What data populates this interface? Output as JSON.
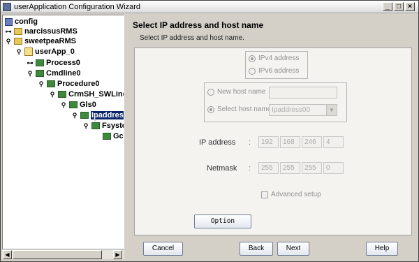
{
  "window": {
    "title": "userApplication Configuration Wizard",
    "controls": [
      "_",
      "□",
      "×"
    ]
  },
  "tree": {
    "items": [
      {
        "label": "config",
        "depth": 0,
        "icon": "config-icon",
        "key": ""
      },
      {
        "label": "narcissusRMS",
        "depth": 0,
        "icon": "node-icon",
        "key": "⊶"
      },
      {
        "label": "sweetpeaRMS",
        "depth": 0,
        "icon": "node-icon",
        "key": "⚲"
      },
      {
        "label": "userApp_0",
        "depth": 1,
        "icon": "app-icon",
        "key": "⚲"
      },
      {
        "label": "Process0",
        "depth": 2,
        "icon": "resource-icon",
        "key": "⊶"
      },
      {
        "label": "Cmdline0",
        "depth": 2,
        "icon": "resource-icon",
        "key": "⚲"
      },
      {
        "label": "Procedure0",
        "depth": 3,
        "icon": "resource-icon",
        "key": "⚲"
      },
      {
        "label": "CrmSH_SWLine",
        "depth": 4,
        "icon": "resource-icon",
        "key": "⚲"
      },
      {
        "label": "Gls0",
        "depth": 5,
        "icon": "resource-icon",
        "key": "⚲"
      },
      {
        "label": "Ipaddress",
        "depth": 6,
        "icon": "resource-icon",
        "key": "⚲",
        "selected": true
      },
      {
        "label": "Fsyste",
        "depth": 7,
        "icon": "resource-icon",
        "key": "⚲"
      },
      {
        "label": "Gc",
        "depth": 8,
        "icon": "resource-icon",
        "key": ""
      }
    ]
  },
  "panel": {
    "heading": "Select IP address and host name",
    "subheading": "Select IP address and host name.",
    "ip_version": {
      "options": [
        "IPv4 address",
        "IPv6 address"
      ],
      "selected": "IPv4 address"
    },
    "host": {
      "new_label": "New host name",
      "new_value": "",
      "select_label": "Select host name",
      "select_value": "Ipaddress00",
      "selected": "Select host name"
    },
    "ip_address": {
      "label": "IP address",
      "colon": ":",
      "octets": [
        "192",
        "168",
        "246",
        "4"
      ]
    },
    "netmask": {
      "label": "Netmask",
      "colon": ":",
      "octets": [
        "255",
        "255",
        "255",
        "0"
      ]
    },
    "advanced_label": "Advanced setup",
    "advanced_checked": false,
    "option_button": "Option"
  },
  "buttons": {
    "cancel": "Cancel",
    "back": "Back",
    "next": "Next",
    "help": "Help"
  }
}
